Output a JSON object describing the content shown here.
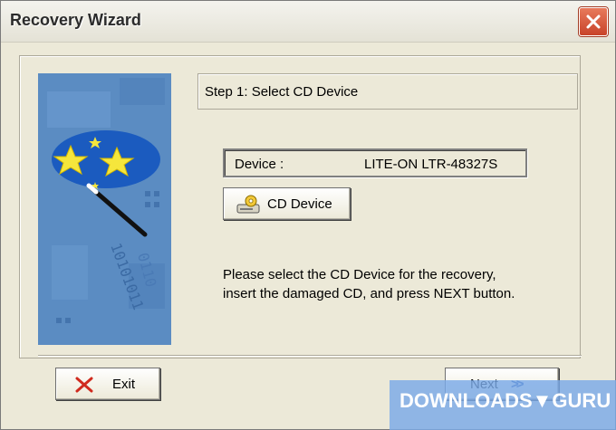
{
  "window": {
    "title": "Recovery Wizard"
  },
  "step": {
    "title": "Step 1: Select CD Device"
  },
  "device": {
    "label": "Device :",
    "value": "LITE-ON  LTR-48327S"
  },
  "buttons": {
    "cd_device": "CD Device",
    "exit": "Exit",
    "next": "Next",
    "next_arrow": ">>"
  },
  "instructions": {
    "line1": "Please select the CD Device for the recovery,",
    "line2": "insert the damaged CD, and press NEXT button."
  },
  "watermark": {
    "text": "DOWNLOADS▼GURU"
  },
  "colors": {
    "dialog_bg": "#ece9d8",
    "image_bg": "#5d8fc4",
    "close_red": "#c8432a",
    "watermark_bg": "#7aaae8"
  },
  "icons": [
    "close-icon",
    "wizard-wand-image",
    "cd-drive-icon",
    "exit-x-icon",
    "next-arrows-icon"
  ]
}
